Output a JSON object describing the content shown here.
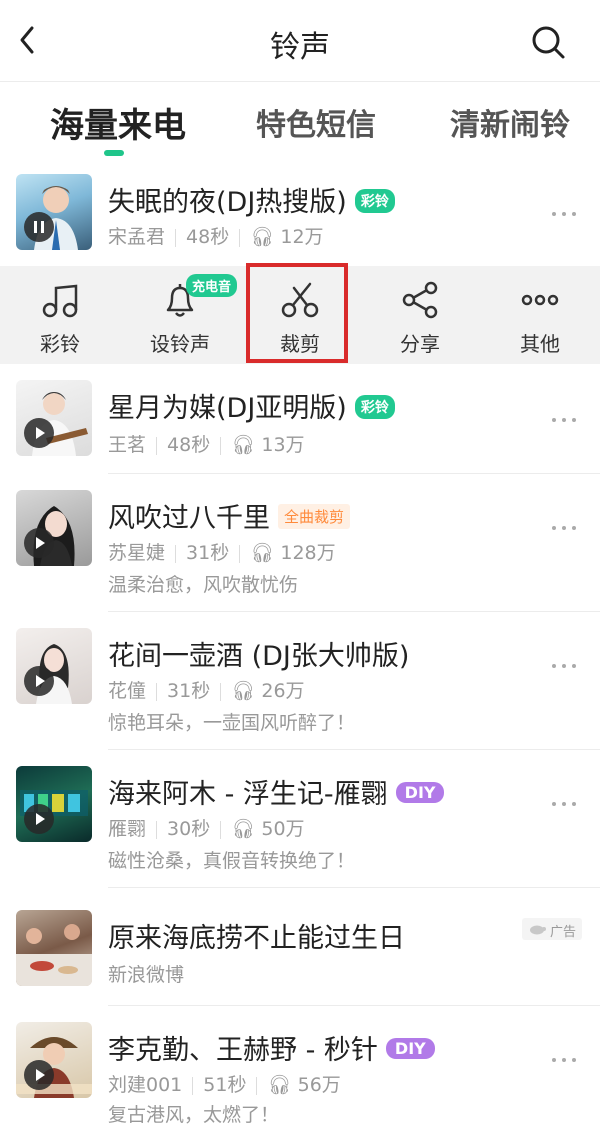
{
  "header": {
    "title": "铃声"
  },
  "tabs": [
    "海量来电",
    "特色短信",
    "清新闹铃"
  ],
  "actions": {
    "items": [
      "彩铃",
      "设铃声",
      "裁剪",
      "分享",
      "其他"
    ],
    "charge_badge": "充电音"
  },
  "songs": [
    {
      "title": "失眠的夜(DJ热搜版)",
      "badge": "彩铃",
      "artist": "宋孟君",
      "duration": "48秒",
      "plays": "12万",
      "desc": ""
    },
    {
      "title": "星月为媒(DJ亚明版)",
      "badge": "彩铃",
      "artist": "王茗",
      "duration": "48秒",
      "plays": "13万",
      "desc": ""
    },
    {
      "title": "风吹过八千里",
      "badge": "全曲裁剪",
      "artist": "苏星婕",
      "duration": "31秒",
      "plays": "128万",
      "desc": "温柔治愈，风吹散忧伤"
    },
    {
      "title": "花间一壶酒 (DJ张大帅版)",
      "badge": "",
      "artist": "花僮",
      "duration": "31秒",
      "plays": "26万",
      "desc": "惊艳耳朵，一壶国风听醉了！"
    },
    {
      "title": "海来阿木 - 浮生记-雁翾",
      "badge": "DIY",
      "artist": "雁翾",
      "duration": "30秒",
      "plays": "50万",
      "desc": "磁性沧桑，真假音转换绝了！"
    },
    {
      "title": "李克勤、王赫野 - 秒针",
      "badge": "DIY",
      "artist": "刘建001",
      "duration": "51秒",
      "plays": "56万",
      "desc": "复古港风，太燃了！"
    }
  ],
  "ad": {
    "title": "原来海底捞不止能过生日",
    "source": "新浪微博",
    "label": "广告"
  },
  "colors": {
    "accent": "#1fc58a",
    "highlight": "#d92b2b",
    "diy": "#b17ae8"
  }
}
